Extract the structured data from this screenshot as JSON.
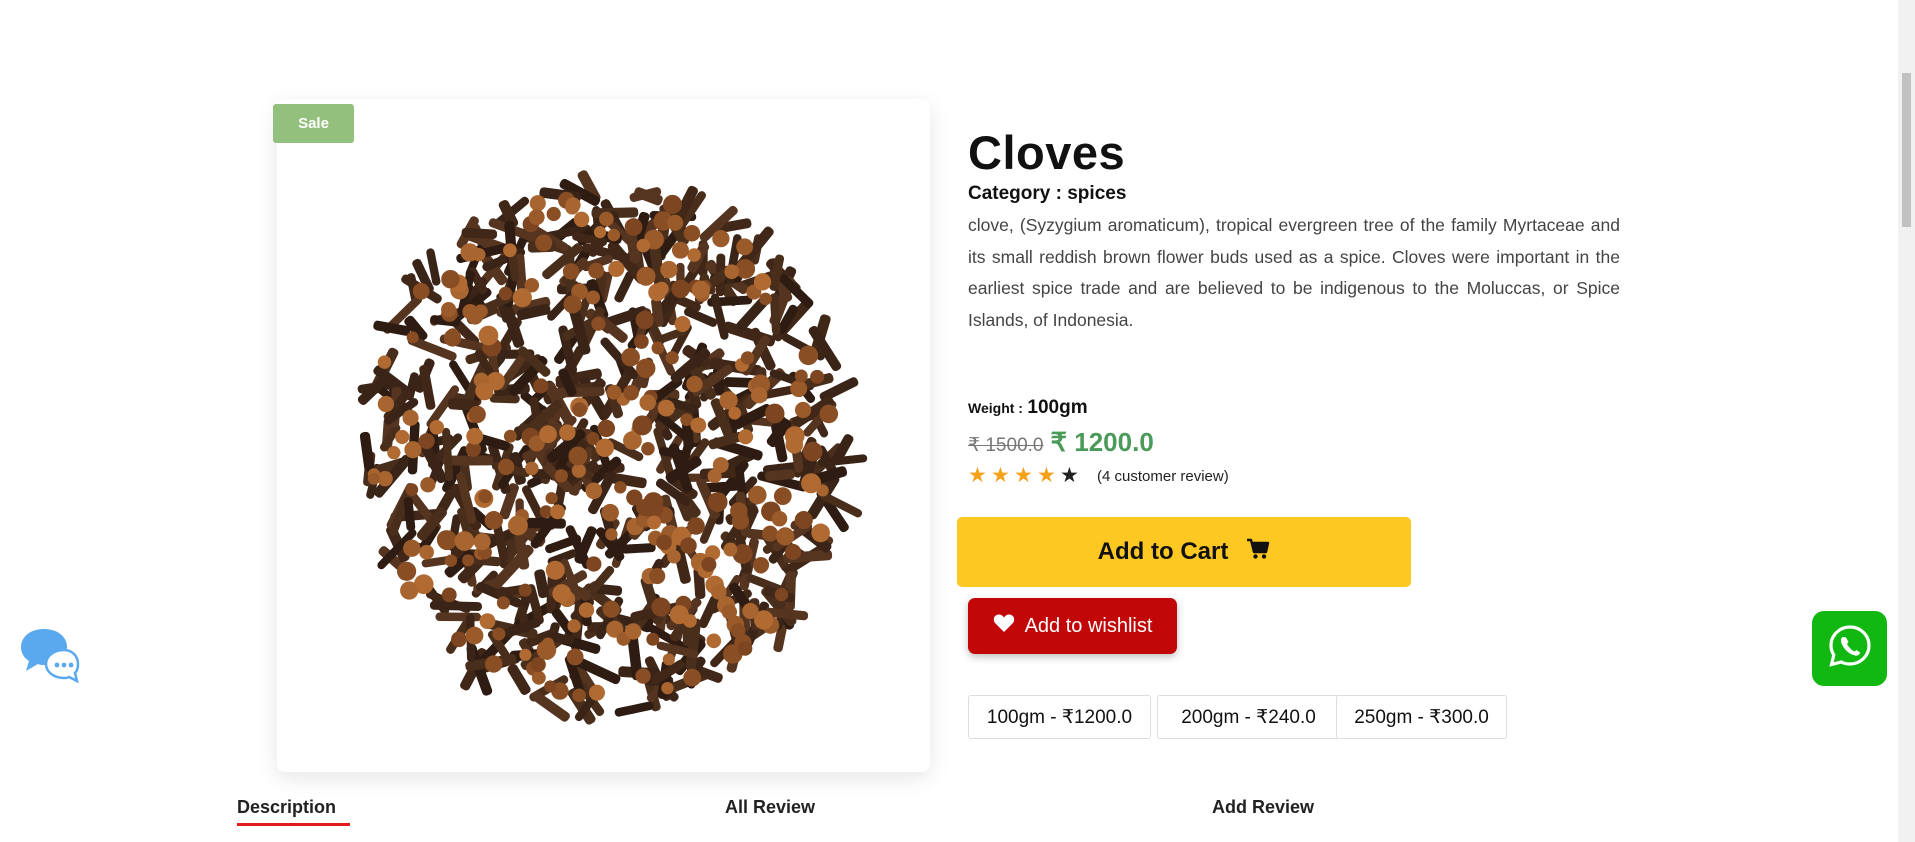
{
  "product": {
    "badge": "Sale",
    "title": "Cloves",
    "category_label": "Category : spices",
    "description": "clove, (Syzygium aromaticum), tropical evergreen tree of the family Myrtaceae and its small reddish brown flower buds used as a spice. Cloves were important in the earliest spice trade and are believed to be indigenous to the Moluccas, or Spice Islands, of Indonesia.",
    "weight_label": "Weight :",
    "weight_value": "100gm",
    "old_price": "₹ 1500.0",
    "new_price": "₹ 1200.0",
    "rating": 4,
    "rating_max": 5,
    "review_text": "(4 customer review)",
    "image_icon": "cloves-product-image"
  },
  "actions": {
    "add_to_cart": "Add to Cart",
    "cart_icon": "cart-icon",
    "add_to_wishlist": "Add to wishlist",
    "wishlist_icon": "heart-icon"
  },
  "variants": [
    "100gm - ₹1200.0",
    "200gm - ₹240.0",
    "250gm - ₹300.0"
  ],
  "tabs": {
    "description": "Description",
    "all_review": "All Review",
    "add_review": "Add Review",
    "active": "Description"
  },
  "floating": {
    "chat_icon": "chat-bubbles-icon",
    "whatsapp_icon": "whatsapp-icon"
  },
  "colors": {
    "sale_badge": "#94c07d",
    "new_price": "#4a9a59",
    "add_to_cart_bg": "#fec823",
    "wishlist_bg": "#c10707",
    "star_filled": "#f5a21a",
    "tab_active_underline": "#e31b1b",
    "whatsapp_bg": "#12b812"
  }
}
